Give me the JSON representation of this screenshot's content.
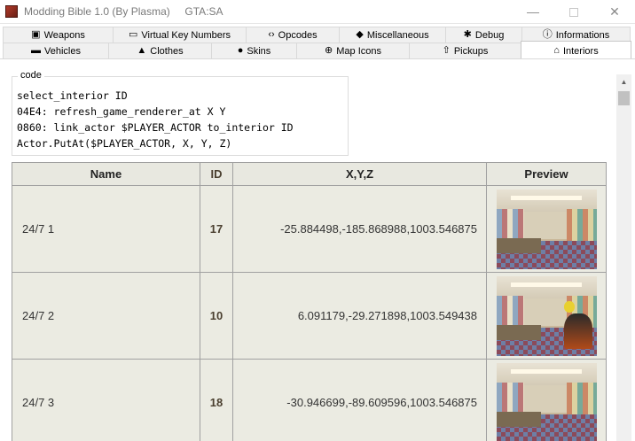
{
  "window": {
    "title": "Modding Bible 1.0 (By Plasma)     GTA:SA",
    "min_symbol": "—",
    "close_symbol": "✕"
  },
  "tabs_row1": [
    {
      "label": "Weapons",
      "icon": "weapons-icon",
      "glyph": "▣"
    },
    {
      "label": "Virtual Key Numbers",
      "icon": "keyboard-icon",
      "glyph": "▭"
    },
    {
      "label": "Opcodes",
      "icon": "code-icon",
      "glyph": "‹›"
    },
    {
      "label": "Miscellaneous",
      "icon": "cube-icon",
      "glyph": "◆"
    },
    {
      "label": "Debug",
      "icon": "bug-icon",
      "glyph": "✱"
    },
    {
      "label": "Informations",
      "icon": "info-icon",
      "glyph": "ⓘ"
    }
  ],
  "tabs_row2": [
    {
      "label": "Vehicles",
      "icon": "car-icon",
      "glyph": "▬"
    },
    {
      "label": "Clothes",
      "icon": "shirt-icon",
      "glyph": "▲"
    },
    {
      "label": "Skins",
      "icon": "person-icon",
      "glyph": "●"
    },
    {
      "label": "Map Icons",
      "icon": "map-icon",
      "glyph": "⊕"
    },
    {
      "label": "Pickups",
      "icon": "upload-icon",
      "glyph": "⇧"
    },
    {
      "label": "Interiors",
      "icon": "home-icon",
      "glyph": "⌂"
    }
  ],
  "active_tab": "Interiors",
  "code": {
    "legend": "code",
    "lines": [
      "select_interior ID",
      "04E4: refresh_game_renderer_at X Y",
      "0860: link_actor $PLAYER_ACTOR to_interior ID",
      "Actor.PutAt($PLAYER_ACTOR, X, Y, Z)"
    ]
  },
  "table": {
    "headers": {
      "name": "Name",
      "id": "ID",
      "xyz": "X,Y,Z",
      "preview": "Preview"
    },
    "rows": [
      {
        "name": "24/7 1",
        "id": "17",
        "xyz": "-25.884498,-185.868988,1003.546875"
      },
      {
        "name": "24/7 2",
        "id": "10",
        "xyz": "6.091179,-29.271898,1003.549438"
      },
      {
        "name": "24/7 3",
        "id": "18",
        "xyz": "-30.946699,-89.609596,1003.546875"
      }
    ]
  },
  "colors": {
    "table_header_bg": "#e8e8e0",
    "row_bg": "#ebebe2",
    "grid": "#a0a0a0"
  }
}
